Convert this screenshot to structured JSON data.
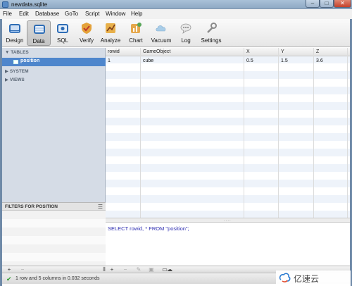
{
  "window": {
    "title": "newdata.sqlite"
  },
  "menu": [
    "File",
    "Edit",
    "Database",
    "GoTo",
    "Script",
    "Window",
    "Help"
  ],
  "toolbar": [
    {
      "label": "Design",
      "icon": "design-icon",
      "active": false
    },
    {
      "label": "Data",
      "icon": "data-icon",
      "active": true
    },
    {
      "label": "SQL",
      "icon": "sql-icon",
      "active": false
    },
    {
      "label": "Verify",
      "icon": "verify-icon",
      "active": false
    },
    {
      "label": "Analyze",
      "icon": "analyze-icon",
      "active": false
    },
    {
      "label": "Chart",
      "icon": "chart-icon",
      "active": false
    },
    {
      "label": "Vacuum",
      "icon": "vacuum-icon",
      "active": false
    },
    {
      "label": "Log",
      "icon": "log-icon",
      "active": false
    },
    {
      "label": "Settings",
      "icon": "settings-icon",
      "active": false
    }
  ],
  "sidebar": {
    "sections": [
      {
        "label": "TABLES",
        "expanded": true
      },
      {
        "label": "SYSTEM",
        "expanded": false
      },
      {
        "label": "VIEWS",
        "expanded": false
      }
    ],
    "selected_table": "position"
  },
  "filters": {
    "title": "FILTERS FOR POSITION"
  },
  "grid": {
    "columns": [
      "rowid",
      "GameObject",
      "X",
      "Y",
      "Z"
    ],
    "rows": [
      [
        "1",
        "cube",
        "0.5",
        "1.5",
        "3.6"
      ]
    ]
  },
  "sql": {
    "select": "SELECT",
    "rest": " rowid, * ",
    "from": "FROM",
    "table": "\"position\"",
    "end": ";"
  },
  "status": {
    "text": "1 row and 5 columns in 0.032 seconds"
  },
  "watermark": {
    "text": "亿速云"
  },
  "colors": {
    "selection": "#4e86cc",
    "sidebar_bg": "#d5dce6",
    "status_ok": "#2f9c2f"
  }
}
